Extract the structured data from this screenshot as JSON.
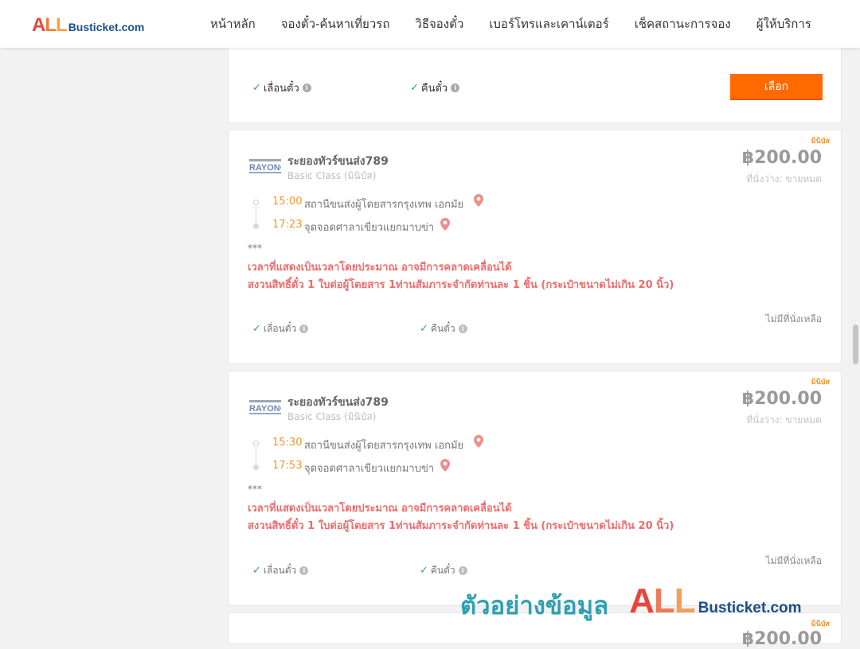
{
  "header": {
    "logo": {
      "a": "A",
      "l1": "L",
      "l2": "L",
      "rest": "Busticket.com"
    },
    "nav": [
      "หน้าหลัก",
      "จองตั๋ว-ค้นหาเที่ยวรถ",
      "วิธีจองตั๋ว",
      "เบอร์โทรและเคาน์เตอร์",
      "เช็คสถานะการจอง",
      "ผู้ให้บริการ"
    ]
  },
  "top_card": {
    "feature_change": "เลื่อนตั๋ว",
    "feature_refund": "คืนตั๋ว",
    "info_icon": "i",
    "select_label": "เลือก",
    "check": "✓"
  },
  "trips": [
    {
      "tag": "มินิบัส",
      "operator": "ระยองทัวร์ขนส่ง789",
      "class": "Basic Class (มินิบัส)",
      "price": "฿200.00",
      "seats": "ที่นั่งว่าง: ขายหมด",
      "depart_time": "15:00",
      "depart_stop": "สถานีขนส่งผู้โดยสารกรุงเทพ เอกมัย",
      "arrive_time": "17:23",
      "arrive_stop": "จุดจอดศาลาเขียวแยกมาบข่า",
      "stars": "***",
      "note1": "เวลาที่แสดงเป็นเวลาโดยประมาณ อาจมีการคลาดเคลื่อนได้",
      "note2": "สงวนสิทธิ์ตั๋ว 1 ใบต่อผู้โดยสาร 1ท่านสัมภาระจำกัดท่านละ 1 ชิ้น (กระเป๋าขนาดไม่เกิน 20 นิ้ว)",
      "feature_change": "เลื่อนตั๋ว",
      "feature_refund": "คืนตั๋ว",
      "no_seat": "ไม่มีที่นั่งเหลือ"
    },
    {
      "tag": "มินิบัส",
      "operator": "ระยองทัวร์ขนส่ง789",
      "class": "Basic Class (มินิบัส)",
      "price": "฿200.00",
      "seats": "ที่นั่งว่าง: ขายหมด",
      "depart_time": "15:30",
      "depart_stop": "สถานีขนส่งผู้โดยสารกรุงเทพ เอกมัย",
      "arrive_time": "17:53",
      "arrive_stop": "จุดจอดศาลาเขียวแยกมาบข่า",
      "stars": "***",
      "note1": "เวลาที่แสดงเป็นเวลาโดยประมาณ อาจมีการคลาดเคลื่อนได้",
      "note2": "สงวนสิทธิ์ตั๋ว 1 ใบต่อผู้โดยสาร 1ท่านสัมภาระจำกัดท่านละ 1 ชิ้น (กระเป๋าขนาดไม่เกิน 20 นิ้ว)",
      "feature_change": "เลื่อนตั๋ว",
      "feature_refund": "คืนตั๋ว",
      "no_seat": "ไม่มีที่นั่งเหลือ"
    }
  ],
  "partial_card": {
    "tag": "มินิบัส",
    "price": "฿200.00"
  },
  "watermark": {
    "text": "ตัวอย่างข้อมูล",
    "a": "A",
    "l1": "L",
    "l2": "L",
    "rest": "Busticket.com"
  },
  "colors": {
    "accent": "#ff6a00",
    "price": "#9a9a9a",
    "note": "#ef6b6b",
    "time": "#f2962f",
    "check": "#3aa655"
  },
  "icons": {
    "check": "check-icon",
    "info": "info-icon",
    "pin": "map-pin-icon",
    "operator_logo": "rayong-logo"
  }
}
